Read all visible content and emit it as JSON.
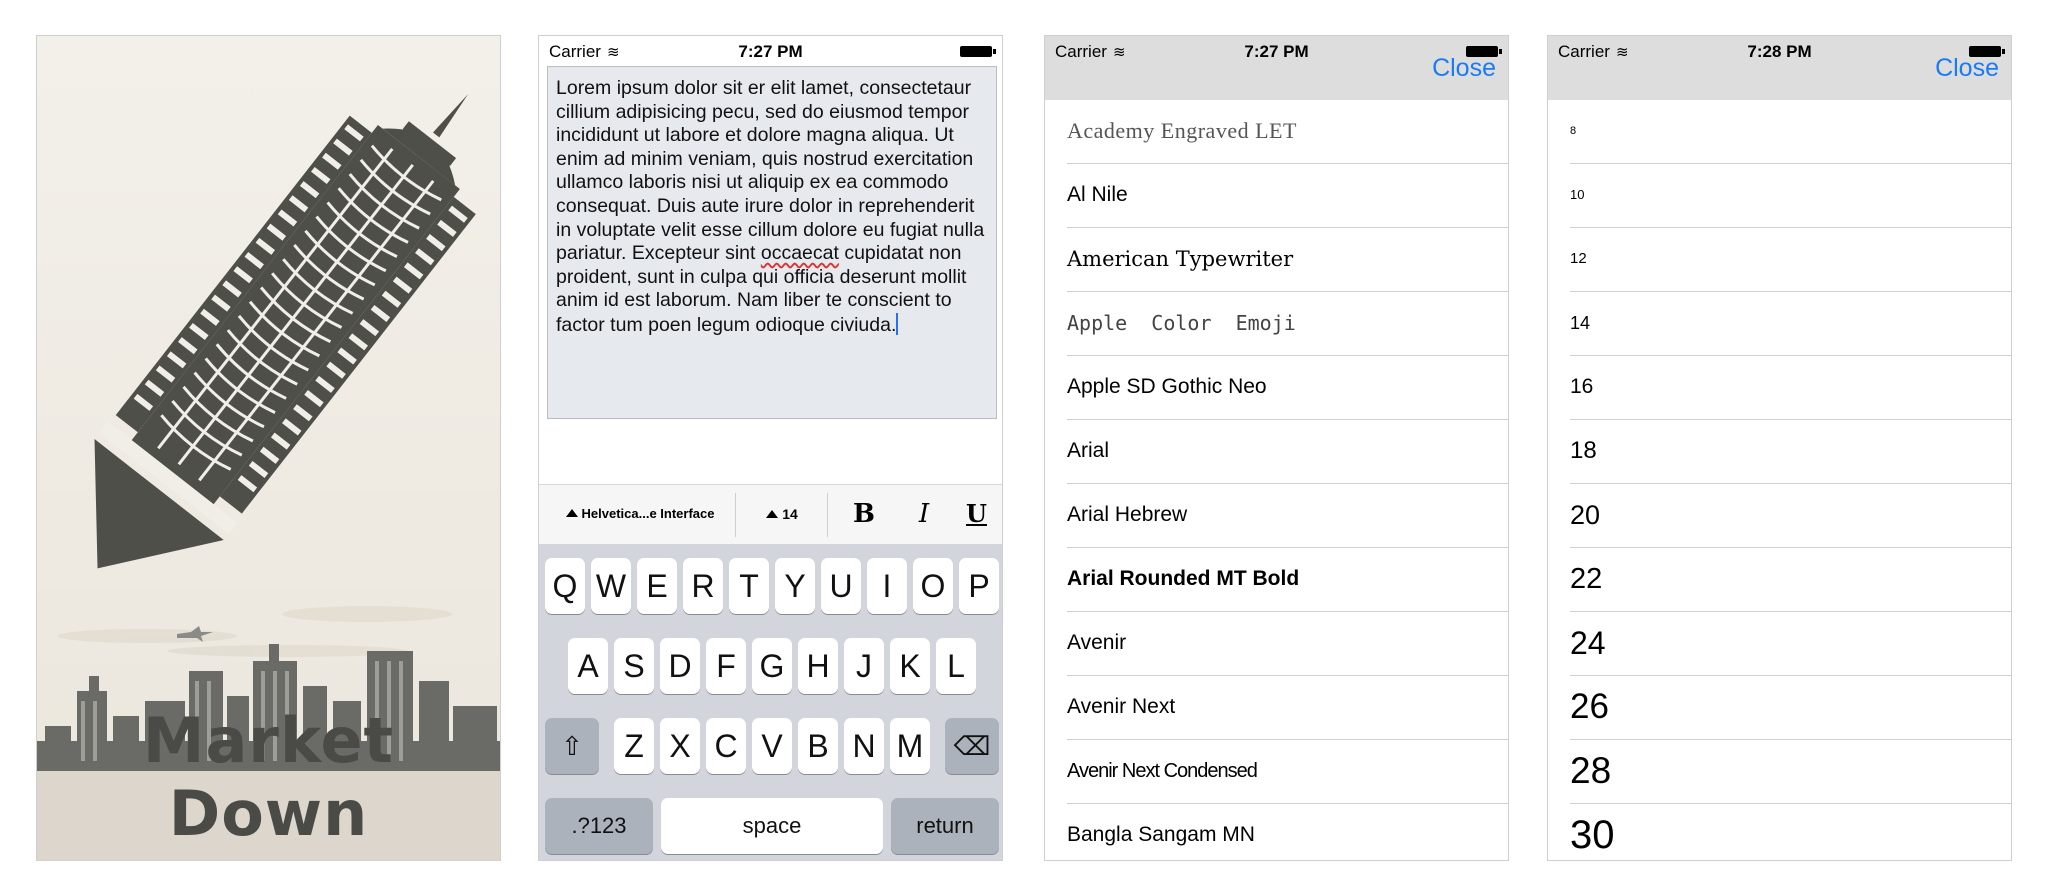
{
  "splash": {
    "title": "Market Down"
  },
  "status_bars": [
    {
      "carrier": "Carrier",
      "time": "7:27 PM"
    },
    {
      "carrier": "Carrier",
      "time": "7:27 PM"
    },
    {
      "carrier": "Carrier",
      "time": "7:28 PM"
    }
  ],
  "editor": {
    "text_before": "Lorem ipsum dolor sit er elit lamet, consectetaur cillium adipisicing pecu, sed do eiusmod tempor incididunt ut labore et dolore magna aliqua. Ut enim ad minim veniam, quis nostrud exercitation ullamco laboris nisi ut aliquip ex ea commodo consequat. Duis aute irure dolor in reprehenderit in voluptate velit esse cillum dolore eu fugiat nulla pariatur. Excepteur sint ",
    "misspelled_word": "occaecat",
    "text_after": " cupidatat non proident, sunt in culpa qui officia deserunt mollit anim id est laborum. Nam liber te conscient to factor tum poen legum odioque civiuda.",
    "toolbar": {
      "font_name": "Helvetica...e Interface",
      "font_size": "14",
      "bold": "B",
      "italic": "I",
      "underline": "U"
    }
  },
  "keyboard": {
    "row1": [
      "Q",
      "W",
      "E",
      "R",
      "T",
      "Y",
      "U",
      "I",
      "O",
      "P"
    ],
    "row2": [
      "A",
      "S",
      "D",
      "F",
      "G",
      "H",
      "J",
      "K",
      "L"
    ],
    "row3": [
      "Z",
      "X",
      "C",
      "V",
      "B",
      "N",
      "M"
    ],
    "numbers": ".?123",
    "space": "space",
    "return": "return"
  },
  "font_picker": {
    "close_label": "Close",
    "fonts": [
      "Academy Engraved LET",
      "Al Nile",
      "American Typewriter",
      "Apple  Color  Emoji",
      "Apple SD Gothic Neo",
      "Arial",
      "Arial Hebrew",
      "Arial Rounded MT Bold",
      "Avenir",
      "Avenir Next",
      "Avenir Next Condensed",
      "Bangla Sangam MN"
    ]
  },
  "size_picker": {
    "close_label": "Close",
    "sizes": [
      "8",
      "10",
      "12",
      "14",
      "16",
      "18",
      "20",
      "22",
      "24",
      "26",
      "28",
      "30"
    ]
  }
}
